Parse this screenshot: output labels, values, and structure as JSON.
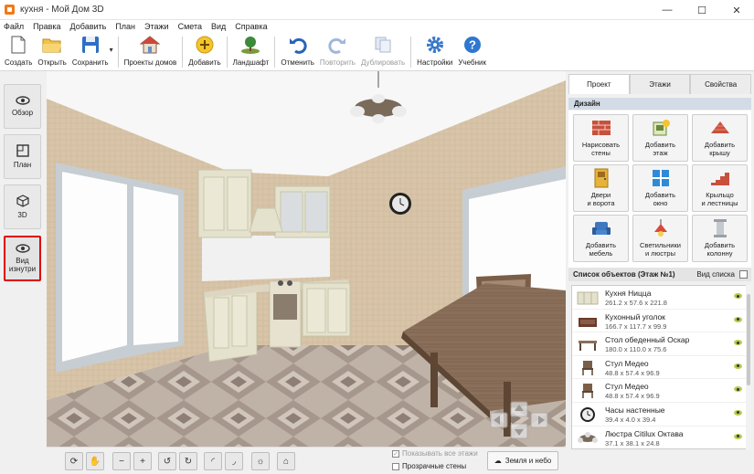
{
  "window": {
    "title": "кухня - Мой Дом 3D",
    "controls": [
      "—",
      "☐",
      "✕"
    ]
  },
  "menu": [
    "Файл",
    "Правка",
    "Добавить",
    "План",
    "Этажи",
    "Смета",
    "Вид",
    "Справка"
  ],
  "toolbar": {
    "create": "Создать",
    "open": "Открыть",
    "save": "Сохранить",
    "house_projects": "Проекты домов",
    "add": "Добавить",
    "landscape": "Ландшафт",
    "undo": "Отменить",
    "redo": "Повторить",
    "duplicate": "Дублировать",
    "settings": "Настройки",
    "tutorial": "Учебник"
  },
  "views": {
    "overview": "Обзор",
    "plan": "План",
    "three_d": "3D",
    "inside": "Вид изнутри"
  },
  "bottom": {
    "show_all_floors": "Показывать все этажи",
    "transparent_walls": "Прозрачные стены",
    "earth_sky": "Земля и небо"
  },
  "tabs": [
    "Проект",
    "Этажи",
    "Свойства"
  ],
  "design": {
    "header": "Дизайн",
    "buttons": [
      {
        "label": "Нарисовать\nстены",
        "icon": "brick-wall-icon"
      },
      {
        "label": "Добавить\nэтаж",
        "icon": "add-floor-icon"
      },
      {
        "label": "Добавить\nкрышу",
        "icon": "roof-icon"
      },
      {
        "label": "Двери\nи ворота",
        "icon": "door-icon"
      },
      {
        "label": "Добавить\nокно",
        "icon": "window-icon"
      },
      {
        "label": "Крыльцо\nи лестницы",
        "icon": "stairs-icon"
      },
      {
        "label": "Добавить\nмебель",
        "icon": "armchair-icon"
      },
      {
        "label": "Светильники\nи люстры",
        "icon": "lamp-icon"
      },
      {
        "label": "Добавить\nколонну",
        "icon": "column-icon"
      }
    ]
  },
  "objects": {
    "header": "Список объектов (Этаж №1)",
    "view_list": "Вид списка",
    "items": [
      {
        "name": "Кухня Ницца",
        "dims": "261.2 x 57.6 x 221.8",
        "icon": "kitchen-icon"
      },
      {
        "name": "Кухонный уголок",
        "dims": "166.7 x 117.7 x 99.9",
        "icon": "corner-bench-icon"
      },
      {
        "name": "Стол обеденный Оскар",
        "dims": "180.0 x 110.0 x 75.6",
        "icon": "table-icon"
      },
      {
        "name": "Стул Медео",
        "dims": "48.8 x 57.4 x 96.9",
        "icon": "chair-icon"
      },
      {
        "name": "Стул Медео",
        "dims": "48.8 x 57.4 x 96.9",
        "icon": "chair-icon"
      },
      {
        "name": "Часы настенные",
        "dims": "39.4 x 4.0 x 39.4",
        "icon": "clock-icon"
      },
      {
        "name": "Люстра Citilux Октава",
        "dims": "37.1 x 38.1 x 24.8",
        "icon": "chandelier-icon"
      }
    ]
  },
  "colors": {
    "accent_red": "#e00000",
    "section_blue": "#d3dbe6",
    "eye_green": "#b7c94a"
  }
}
